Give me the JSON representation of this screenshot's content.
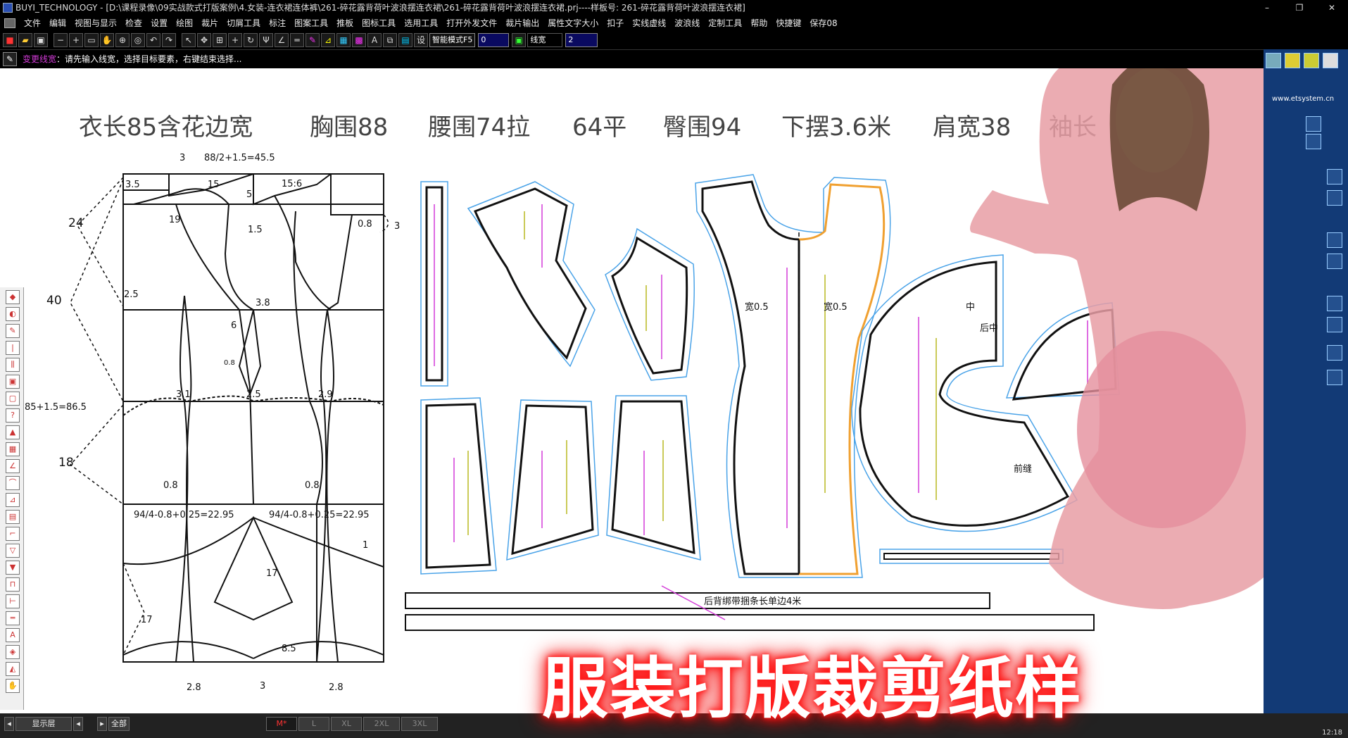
{
  "app": {
    "title": "BUYI_TECHNOLOGY - [D:\\课程录像\\09实战款式打版案例\\4.女装-连衣裙连体裤\\261-碎花露背荷叶波浪摆连衣裙\\261-碎花露背荷叶波浪摆连衣裙.prj----样板号: 261-碎花露背荷叶波浪摆连衣裙]"
  },
  "menu": [
    "文件",
    "编辑",
    "视图与显示",
    "检查",
    "设置",
    "绘图",
    "裁片",
    "切屑工具",
    "标注",
    "图案工具",
    "推板",
    "图标工具",
    "选用工具",
    "打开外发文件",
    "裁片输出",
    "属性文字大小",
    "扣子",
    "实线虚线",
    "波浪线",
    "定制工具",
    "帮助",
    "快捷键",
    "保存08"
  ],
  "toolbar": {
    "mode": "智能模式F5",
    "value1": "0",
    "label_linewidth": "线宽",
    "value2": "2",
    "settings_label": "设"
  },
  "prompt": {
    "command": "变更线宽",
    "text": "：请先输入线宽，选择目标要素，右键结束选择..."
  },
  "canvas": {
    "spec_line": [
      "衣长85含花边宽",
      "胸围88",
      "腰围74拉",
      "64平",
      "臀围94",
      "下摆3.6米",
      "肩宽38",
      "袖长"
    ],
    "draft_labels": {
      "top_formula": "88/2+1.5=45.5",
      "l3": "3",
      "l35": "3.5",
      "l15": "15",
      "l156": "15:6",
      "l5": "5",
      "l19": "19",
      "l08a": "0.8",
      "l3b": "3",
      "l15b": "1.5",
      "l24": "24",
      "l40": "40",
      "l25": "2.5",
      "l38": "3.8",
      "l6": "6",
      "l08b": "0.8",
      "l865": "85+1.5=86.5",
      "l31": "3.1",
      "l25b": "2.5",
      "l29": "2.9",
      "l18": "18",
      "l08c": "0.8",
      "l08d": "0.8",
      "hipL": "94/4-0.8+0.25=22.95",
      "hipR": "94/4-0.8+0.25=22.95",
      "l1": "1",
      "l17": "17",
      "l17b": "17",
      "l85": "8.5",
      "b28a": "2.8",
      "b3": "3",
      "b28b": "2.8"
    },
    "piece_labels": {
      "p05a": "宽0.5",
      "p05b": "宽0.5",
      "zhong": "中",
      "houzhong": "后中",
      "jiaofeng": "前缝",
      "belt": "后背绑带捆条长单边4米"
    },
    "caption": "服装打版裁剪纸样"
  },
  "right_panel": {
    "site": "www.etsystem.cn"
  },
  "status": {
    "layer": "显示层",
    "all": "全部",
    "sizes": [
      "M*",
      "L",
      "XL",
      "2XL",
      "3XL"
    ],
    "time": "12:18"
  },
  "colors": {
    "accent": "#ff1a1a",
    "panel": "#123a76",
    "magenta": "#d33bd8",
    "orange": "#f0a030",
    "blue": "#4aa3e8"
  }
}
